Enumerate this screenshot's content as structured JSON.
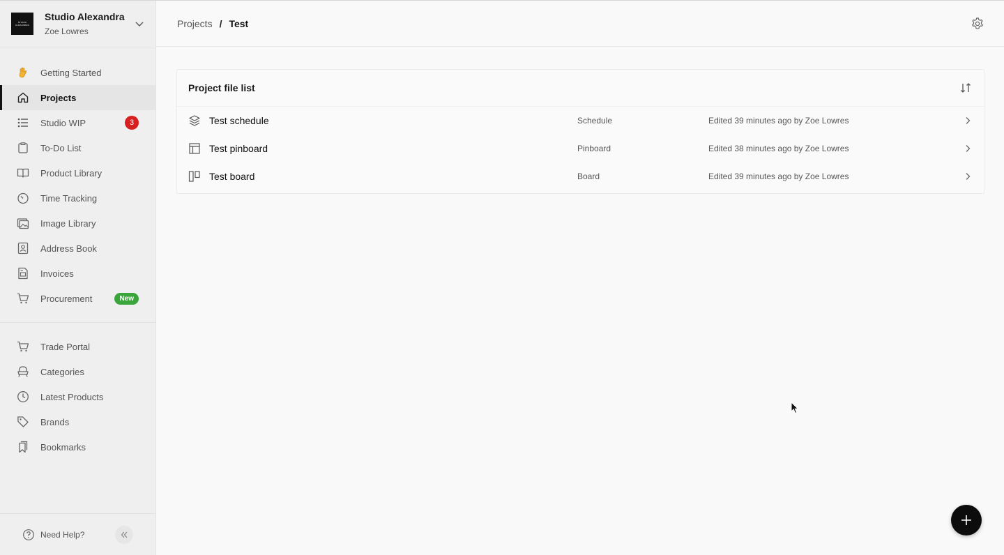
{
  "workspace": {
    "name": "Studio Alexandra",
    "user": "Zoe Lowres",
    "logo_text": "STUDIO ALEXANDRA"
  },
  "nav": {
    "primary": [
      {
        "label": "Getting Started",
        "icon": "waving-hand-icon"
      },
      {
        "label": "Projects",
        "icon": "home-icon",
        "active": true
      },
      {
        "label": "Studio WIP",
        "icon": "list-icon",
        "badge": "3"
      },
      {
        "label": "To-Do List",
        "icon": "clipboard-icon"
      },
      {
        "label": "Product Library",
        "icon": "book-icon"
      },
      {
        "label": "Time Tracking",
        "icon": "timer-icon"
      },
      {
        "label": "Image Library",
        "icon": "image-icon"
      },
      {
        "label": "Address Book",
        "icon": "contact-book-icon"
      },
      {
        "label": "Invoices",
        "icon": "invoice-icon"
      },
      {
        "label": "Procurement",
        "icon": "cart-icon",
        "badge": "New"
      }
    ],
    "secondary": [
      {
        "label": "Trade Portal",
        "icon": "cart-icon"
      },
      {
        "label": "Categories",
        "icon": "chair-icon"
      },
      {
        "label": "Latest Products",
        "icon": "clock-icon"
      },
      {
        "label": "Brands",
        "icon": "tag-icon"
      },
      {
        "label": "Bookmarks",
        "icon": "bookmark-icon"
      }
    ]
  },
  "footer": {
    "help_label": "Need Help?"
  },
  "breadcrumb": {
    "parent": "Projects",
    "separator": "/",
    "current": "Test"
  },
  "panel": {
    "title": "Project file list",
    "rows": [
      {
        "name": "Test schedule",
        "type": "Schedule",
        "edited": "Edited 39 minutes ago by Zoe Lowres",
        "icon": "layers-icon"
      },
      {
        "name": "Test pinboard",
        "type": "Pinboard",
        "edited": "Edited 38 minutes ago by Zoe Lowres",
        "icon": "layout-icon"
      },
      {
        "name": "Test board",
        "type": "Board",
        "edited": "Edited 39 minutes ago by Zoe Lowres",
        "icon": "kanban-icon"
      }
    ]
  },
  "colors": {
    "badge_red": "#d92020",
    "badge_green": "#3aa53a",
    "fab": "#0c0c0c"
  }
}
